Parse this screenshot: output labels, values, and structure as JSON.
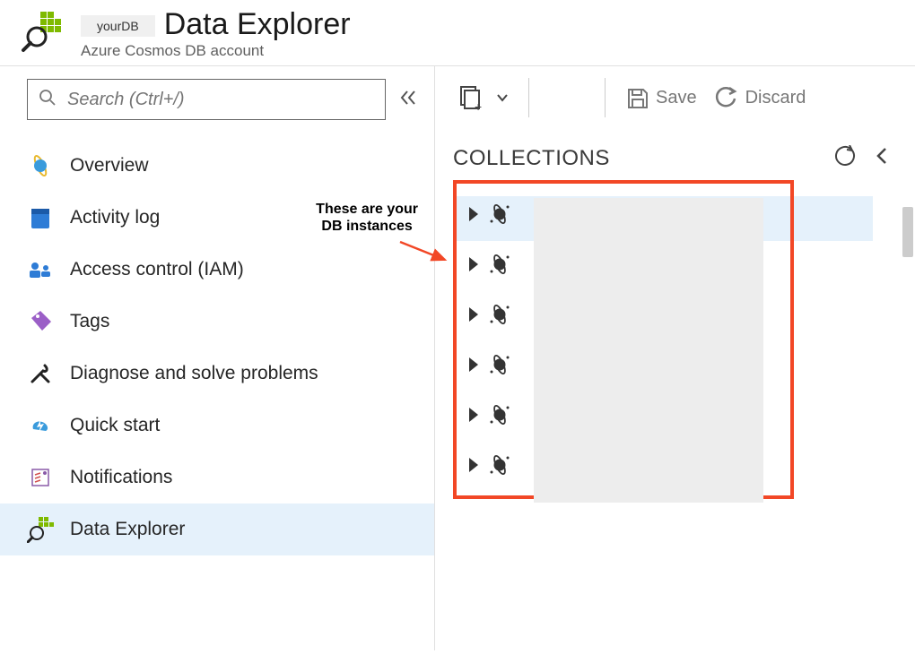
{
  "header": {
    "db_chip": "yourDB",
    "title": "Data Explorer",
    "subtitle": "Azure Cosmos DB account"
  },
  "sidebar": {
    "search_placeholder": "Search (Ctrl+/)",
    "items": [
      {
        "label": "Overview",
        "icon": "planet"
      },
      {
        "label": "Activity log",
        "icon": "log"
      },
      {
        "label": "Access control (IAM)",
        "icon": "iam"
      },
      {
        "label": "Tags",
        "icon": "tag"
      },
      {
        "label": "Diagnose and solve problems",
        "icon": "tools"
      },
      {
        "label": "Quick start",
        "icon": "bolt"
      },
      {
        "label": "Notifications",
        "icon": "bell"
      },
      {
        "label": "Data Explorer",
        "icon": "explorer"
      }
    ],
    "selected_index": 7
  },
  "annotation": {
    "line1": "These are your",
    "line2": "DB instances"
  },
  "toolbar": {
    "save_label": "Save",
    "discard_label": "Discard"
  },
  "collections": {
    "title": "COLLECTIONS",
    "items": [
      {
        "expanded": false
      },
      {
        "expanded": false
      },
      {
        "expanded": false
      },
      {
        "expanded": false
      },
      {
        "expanded": false
      },
      {
        "expanded": false
      }
    ],
    "selected_index": 0
  }
}
